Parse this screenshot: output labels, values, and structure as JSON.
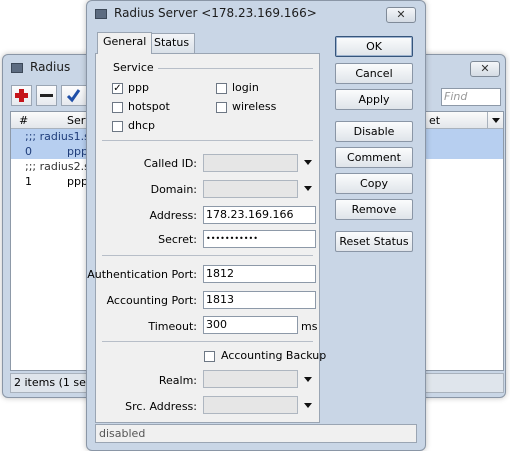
{
  "bg_window": {
    "title": "Radius",
    "find_placeholder": "Find",
    "columns": [
      "#",
      "Serv",
      "et"
    ],
    "rows": [
      {
        "text": ";;; radius1.se",
        "num": "",
        "service": ""
      },
      {
        "text": "",
        "num": "0",
        "service": "ppp"
      },
      {
        "text": ";;; radius2.se",
        "num": "",
        "service": ""
      },
      {
        "text": "",
        "num": "1",
        "service": "ppp"
      }
    ],
    "status": "2 items (1 select"
  },
  "dialog": {
    "title": "Radius Server <178.23.169.166>",
    "tabs": [
      "General",
      "Status"
    ],
    "service_group": "Service",
    "services": [
      {
        "label": "ppp",
        "checked": true
      },
      {
        "label": "login",
        "checked": false
      },
      {
        "label": "hotspot",
        "checked": false
      },
      {
        "label": "wireless",
        "checked": false
      },
      {
        "label": "dhcp",
        "checked": false
      }
    ],
    "fields": {
      "called_id_label": "Called ID:",
      "called_id": "",
      "domain_label": "Domain:",
      "domain": "",
      "address_label": "Address:",
      "address": "178.23.169.166",
      "secret_label": "Secret:",
      "secret": "•••••••••••",
      "auth_port_label": "Authentication Port:",
      "auth_port": "1812",
      "acct_port_label": "Accounting Port:",
      "acct_port": "1813",
      "timeout_label": "Timeout:",
      "timeout": "300",
      "timeout_unit": "ms",
      "acct_backup_label": "Accounting Backup",
      "realm_label": "Realm:",
      "realm": "",
      "src_address_label": "Src. Address:",
      "src_address": ""
    },
    "buttons": [
      "OK",
      "Cancel",
      "Apply",
      "Disable",
      "Comment",
      "Copy",
      "Remove",
      "Reset Status"
    ],
    "status": "disabled"
  }
}
